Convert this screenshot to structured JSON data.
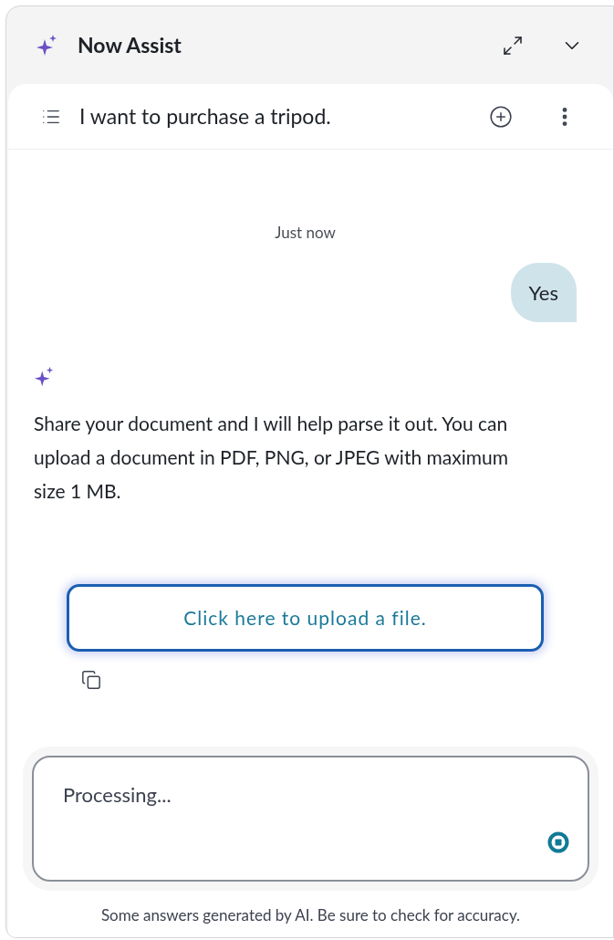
{
  "header": {
    "title": "Now Assist"
  },
  "conversation": {
    "title": "I want to purchase a tripod."
  },
  "messages": [
    {
      "kind": "timestamp",
      "text": "Just now"
    },
    {
      "kind": "user",
      "text": "Yes"
    },
    {
      "kind": "assistant",
      "text": "Share your document and I will help parse it out. You can upload a document in PDF, PNG, or JPEG with maximum size 1 MB."
    },
    {
      "kind": "action",
      "text": "Click here to upload a file."
    }
  ],
  "composer": {
    "placeholder": "Processing..."
  },
  "disclaimer": "Some answers generated by AI. Be sure to check for accuracy."
}
